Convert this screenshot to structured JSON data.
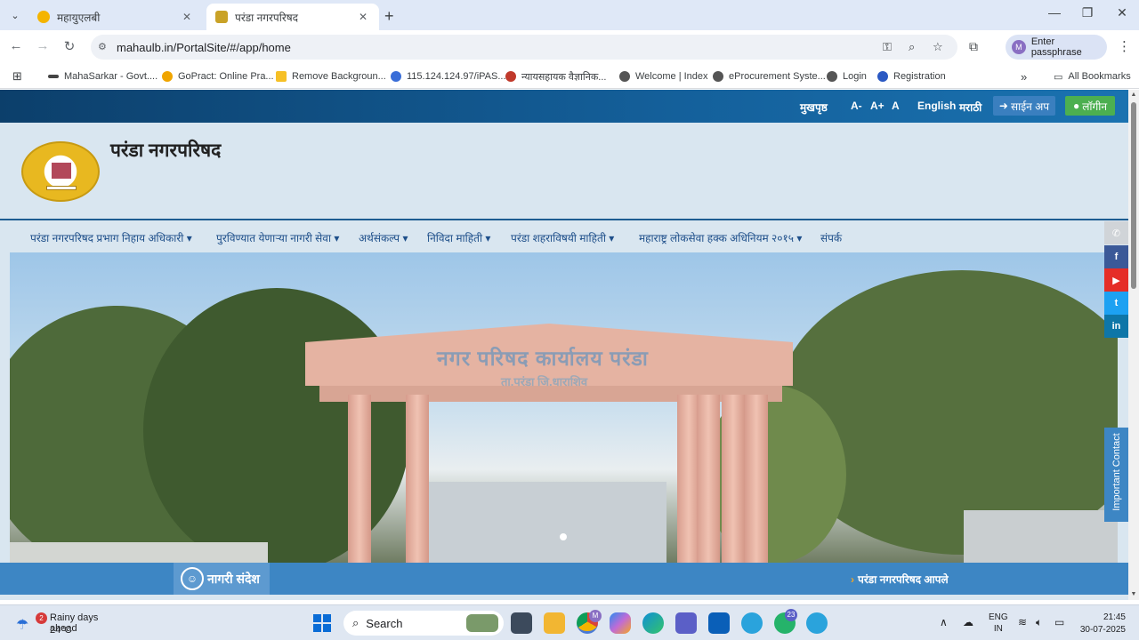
{
  "browser": {
    "tabs": [
      {
        "title": "महायुएलबी",
        "active": false,
        "favicon_color": "#f4b400"
      },
      {
        "title": "परंडा नगरपरिषद",
        "active": true,
        "favicon_color": "#c9a227"
      }
    ],
    "new_tab_glyph": "+",
    "address": {
      "url": "mahaulb.in/PortalSite/#/app/home"
    },
    "profile_label": "Enter passphrase",
    "profile_initial": "M",
    "bookmarks": [
      {
        "label": "MahaSarkar - Govt....",
        "icon_color": "#444"
      },
      {
        "label": "GoPract: Online Pra...",
        "icon_color": "#f0a500"
      },
      {
        "label": "Remove Backgroun...",
        "icon_color": "#f6c026"
      },
      {
        "label": "115.124.124.97/iPAS...",
        "icon_color": "#3a6ed8"
      },
      {
        "label": "न्यायसहायक वैज्ञानिक...",
        "icon_color": "#c0392b"
      },
      {
        "label": "Welcome | Index",
        "icon_color": "#555"
      },
      {
        "label": "eProcurement Syste...",
        "icon_color": "#555"
      },
      {
        "label": "Login",
        "icon_color": "#555"
      },
      {
        "label": "Registration",
        "icon_color": "#2b59c3"
      }
    ],
    "all_bookmarks_label": "All Bookmarks"
  },
  "site": {
    "topbar": {
      "home": "मुखपृष्ठ",
      "font_minus": "A-",
      "font_plus": "A+",
      "font_reset": "A",
      "lang_en": "English",
      "lang_mr": "मराठी",
      "signup": "साईन अप",
      "login": "लॉगीन"
    },
    "title": "परंडा नगरपरिषद",
    "logo_text": "नगर परिषद परंडा",
    "nav": [
      "परंडा नगरपरिषद प्रभाग निहाय अधिकारी ▾",
      "पुरविण्यात येणाऱ्या नागरी सेवा ▾",
      "अर्थसंकल्प ▾",
      "निविदा माहिती ▾",
      "परंडा शहराविषयी माहिती ▾",
      "महाराष्ट्र लोकसेवा हक्क अधिनियम २०१५ ▾",
      "संपर्क"
    ],
    "hero": {
      "sign_main": "नगर परिषद कार्यालय परंडा",
      "sign_sub": "ता.परंडा जि.धाराशिव"
    },
    "ticker": {
      "badge": "नागरी संदेश",
      "message": "परंडा नगरपरिषद आपले"
    },
    "social": [
      {
        "name": "phone",
        "glyph": "✆",
        "color": "#d0d4d8"
      },
      {
        "name": "facebook",
        "glyph": "f",
        "color": "#3b5998"
      },
      {
        "name": "youtube",
        "glyph": "▶",
        "color": "#e52d27"
      },
      {
        "name": "twitter",
        "glyph": "t",
        "color": "#1da1f2"
      },
      {
        "name": "linkedin",
        "glyph": "in",
        "color": "#0e76a8"
      }
    ],
    "important_contact": "Important Contact"
  },
  "taskbar": {
    "weather_line1": "Rainy days ahead",
    "weather_line2": "24°C",
    "weather_badge": "2",
    "search_label": "Search",
    "chrome_badge": "M",
    "whatsapp_badge": "23",
    "lang_line1": "ENG",
    "lang_line2": "IN",
    "time": "21:45",
    "date": "30-07-2025"
  }
}
